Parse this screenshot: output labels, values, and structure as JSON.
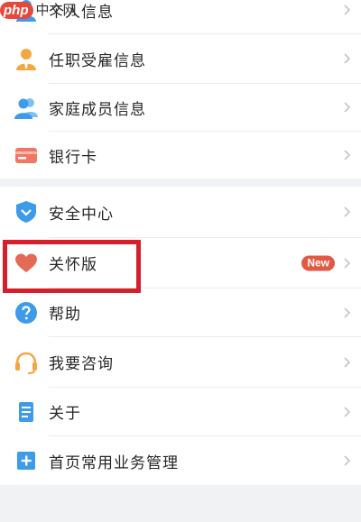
{
  "watermark": {
    "logo": "php",
    "text": "中文网"
  },
  "group1": [
    {
      "label": "个人信息",
      "icon": "person-icon"
    },
    {
      "label": "任职受雇信息",
      "icon": "employee-icon"
    },
    {
      "label": "家庭成员信息",
      "icon": "family-icon"
    },
    {
      "label": "银行卡",
      "icon": "bank-card-icon"
    }
  ],
  "group2": [
    {
      "label": "安全中心",
      "icon": "shield-icon"
    },
    {
      "label": "关怀版",
      "icon": "heart-icon",
      "badge": "New"
    },
    {
      "label": "帮助",
      "icon": "help-icon"
    },
    {
      "label": "我要咨询",
      "icon": "headset-icon"
    },
    {
      "label": "关于",
      "icon": "document-icon"
    },
    {
      "label": "首页常用业务管理",
      "icon": "plus-square-icon"
    }
  ],
  "colors": {
    "highlight_box": "#d61f2a",
    "badge": "#e05a44",
    "accent_blue": "#3d9be9",
    "accent_orange": "#f4a640"
  }
}
